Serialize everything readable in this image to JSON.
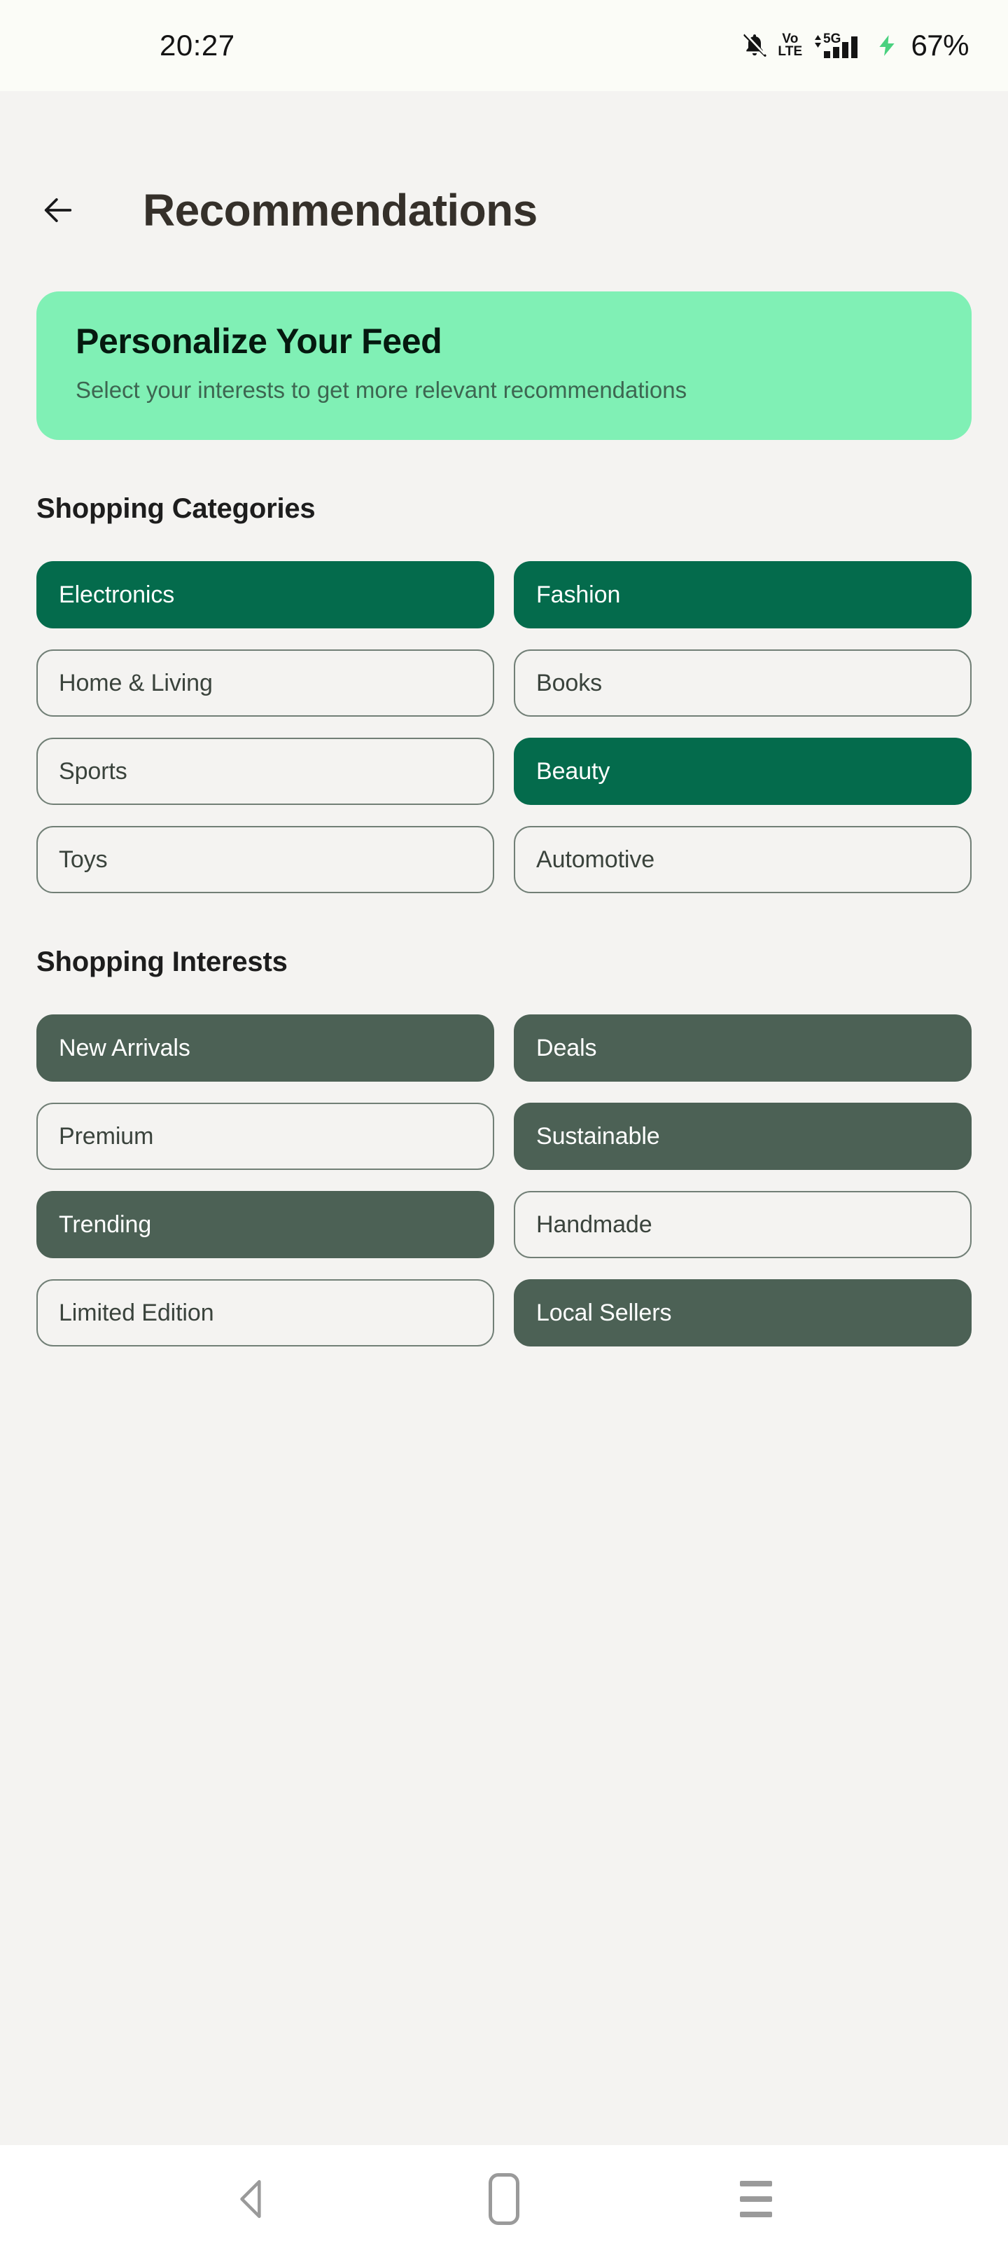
{
  "status_bar": {
    "time": "20:27",
    "battery": "67%",
    "volte_top": "Vo",
    "volte_bottom": "LTE",
    "network_label": "5G",
    "icons": [
      "notifications-muted-icon",
      "volte-icon",
      "signal-5g-icon",
      "charging-bolt-icon"
    ],
    "charging_color": "#4ad17f",
    "background": "#fbfcf7"
  },
  "header": {
    "back_label": "Back",
    "title": "Recommendations"
  },
  "banner": {
    "title": "Personalize Your Feed",
    "subtitle": "Select your interests to get more relevant recommendations",
    "background": "#80f0b5",
    "title_color": "#05190f",
    "subtitle_color": "#3d6651"
  },
  "categories_section": {
    "title": "Shopping Categories",
    "selected_color": "#046b4c",
    "chips": [
      {
        "label": "Electronics",
        "selected": true
      },
      {
        "label": "Fashion",
        "selected": true
      },
      {
        "label": "Home & Living",
        "selected": false
      },
      {
        "label": "Books",
        "selected": false
      },
      {
        "label": "Sports",
        "selected": false
      },
      {
        "label": "Beauty",
        "selected": true
      },
      {
        "label": "Toys",
        "selected": false
      },
      {
        "label": "Automotive",
        "selected": false
      }
    ]
  },
  "interests_section": {
    "title": "Shopping Interests",
    "selected_color": "#4c6155",
    "chips": [
      {
        "label": "New Arrivals",
        "selected": true
      },
      {
        "label": "Deals",
        "selected": true
      },
      {
        "label": "Premium",
        "selected": false
      },
      {
        "label": "Sustainable",
        "selected": true
      },
      {
        "label": "Trending",
        "selected": true
      },
      {
        "label": "Handmade",
        "selected": false
      },
      {
        "label": "Limited Edition",
        "selected": false
      },
      {
        "label": "Local Sellers",
        "selected": true
      }
    ]
  },
  "nav_bar": {
    "items": [
      {
        "name": "back",
        "icon": "triangle-back-icon"
      },
      {
        "name": "home",
        "icon": "rounded-square-home-icon"
      },
      {
        "name": "recents",
        "icon": "hamburger-recents-icon"
      }
    ]
  }
}
